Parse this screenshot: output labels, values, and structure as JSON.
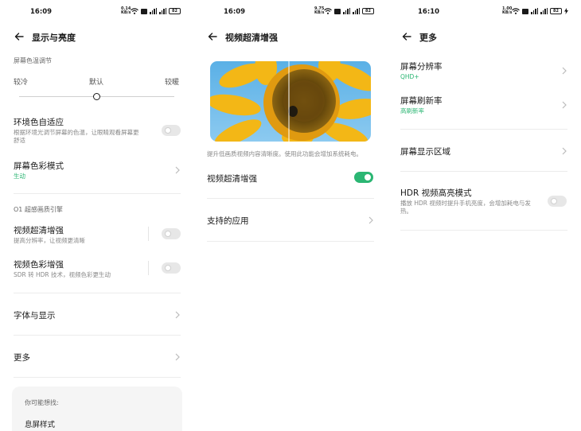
{
  "screen1": {
    "time": "16:09",
    "net_top": "0.14",
    "net_bottom": "KB/s",
    "battery": "82",
    "title": "显示与亮度",
    "color_temp_caption": "屏幕色温调节",
    "temp_cold": "较冷",
    "temp_default": "默认",
    "temp_warm": "较暖",
    "ambient_title": "环境色自适应",
    "ambient_sub1": "根据环境光调节屏幕的色温，让眼睛观看屏幕更",
    "ambient_sub2": "舒适",
    "color_mode_title": "屏幕色彩模式",
    "color_mode_value": "生动",
    "engine_caption": "O1 超感画质引擎",
    "video_enh_title": "视频超清增强",
    "video_enh_sub": "提高分辨率，让视频更清晰",
    "video_color_title": "视频色彩增强",
    "video_color_sub": "SDR 转 HDR 技术，视频色彩更生动",
    "font_title": "字体与显示",
    "more_title": "更多",
    "suggest_caption": "你可能想找:",
    "suggest_item": "息屏样式"
  },
  "screen2": {
    "time": "16:09",
    "net_top": "9.75",
    "net_bottom": "KB/s",
    "battery": "82",
    "title": "视频超清增强",
    "description": "提升低画质视频内容清晰度。使用此功能会增加系统耗电。",
    "toggle_title": "视频超清增强",
    "apps_title": "支持的应用"
  },
  "screen3": {
    "time": "16:10",
    "net_top": "1.00",
    "net_bottom": "KB/s",
    "battery": "82",
    "title": "更多",
    "resolution_title": "屏幕分辨率",
    "resolution_value": "QHD+",
    "refresh_title": "屏幕刷新率",
    "refresh_value": "高刷新率",
    "area_title": "屏幕显示区域",
    "hdr_title": "HDR 视频高亮模式",
    "hdr_sub1": "播放 HDR 视频时提升手机亮度，会增加耗电与发",
    "hdr_sub2": "热。"
  },
  "colors": {
    "accent": "#2bb673",
    "text": "#1a1a1a",
    "muted": "#888888",
    "divider": "#ececec"
  }
}
